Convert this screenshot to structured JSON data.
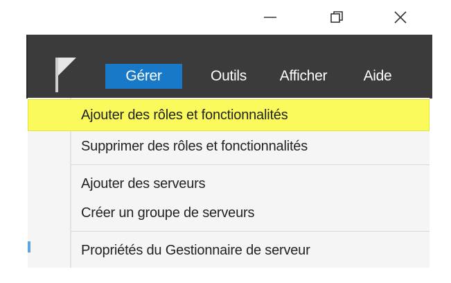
{
  "window_controls": {
    "minimize": "—",
    "restore": "❐",
    "close": "✕"
  },
  "menubar": {
    "items": [
      {
        "label": "Gérer",
        "active": true
      },
      {
        "label": "Outils",
        "active": false
      },
      {
        "label": "Afficher",
        "active": false
      },
      {
        "label": "Aide",
        "active": false
      }
    ]
  },
  "dropdown": {
    "items": [
      {
        "label": "Ajouter des rôles et fonctionnalités",
        "highlighted": true
      },
      {
        "label": "Supprimer des rôles et fonctionnalités"
      },
      {
        "label": "Ajouter des serveurs"
      },
      {
        "label": "Créer un groupe de serveurs"
      },
      {
        "label": "Propriétés du Gestionnaire de serveur"
      }
    ]
  },
  "colors": {
    "menubar_bg": "#3b3b3b",
    "active_menu": "#1979c9",
    "highlight": "#fafa5c",
    "dropdown_bg": "#f5f5f5"
  },
  "icons": {
    "notification_flag": "flag-icon"
  }
}
